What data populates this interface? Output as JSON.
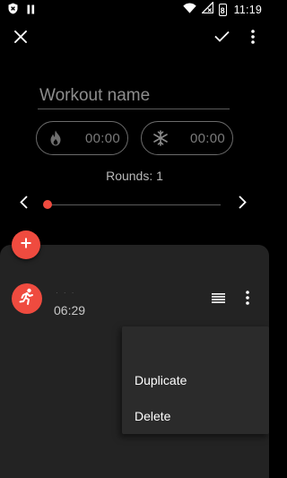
{
  "status_bar": {
    "time": "11:19",
    "battery_level": "8"
  },
  "toolbar": {
    "close_icon": "close-icon",
    "confirm_icon": "check-icon",
    "more_icon": "more-vert-icon"
  },
  "workout": {
    "name_placeholder": "Workout name",
    "name_value": "",
    "work_time": "00:00",
    "rest_time": "00:00",
    "rounds_label": "Rounds: 1",
    "rounds_value": 1
  },
  "exercise": {
    "name": "· · ·",
    "duration": "06:29"
  },
  "context_menu": {
    "items": [
      {
        "label": "Duplicate"
      },
      {
        "label": "Delete"
      }
    ]
  },
  "colors": {
    "accent": "#ef4b3f",
    "background": "#000000",
    "sheet": "#232323",
    "menu": "#2b2b2b"
  }
}
